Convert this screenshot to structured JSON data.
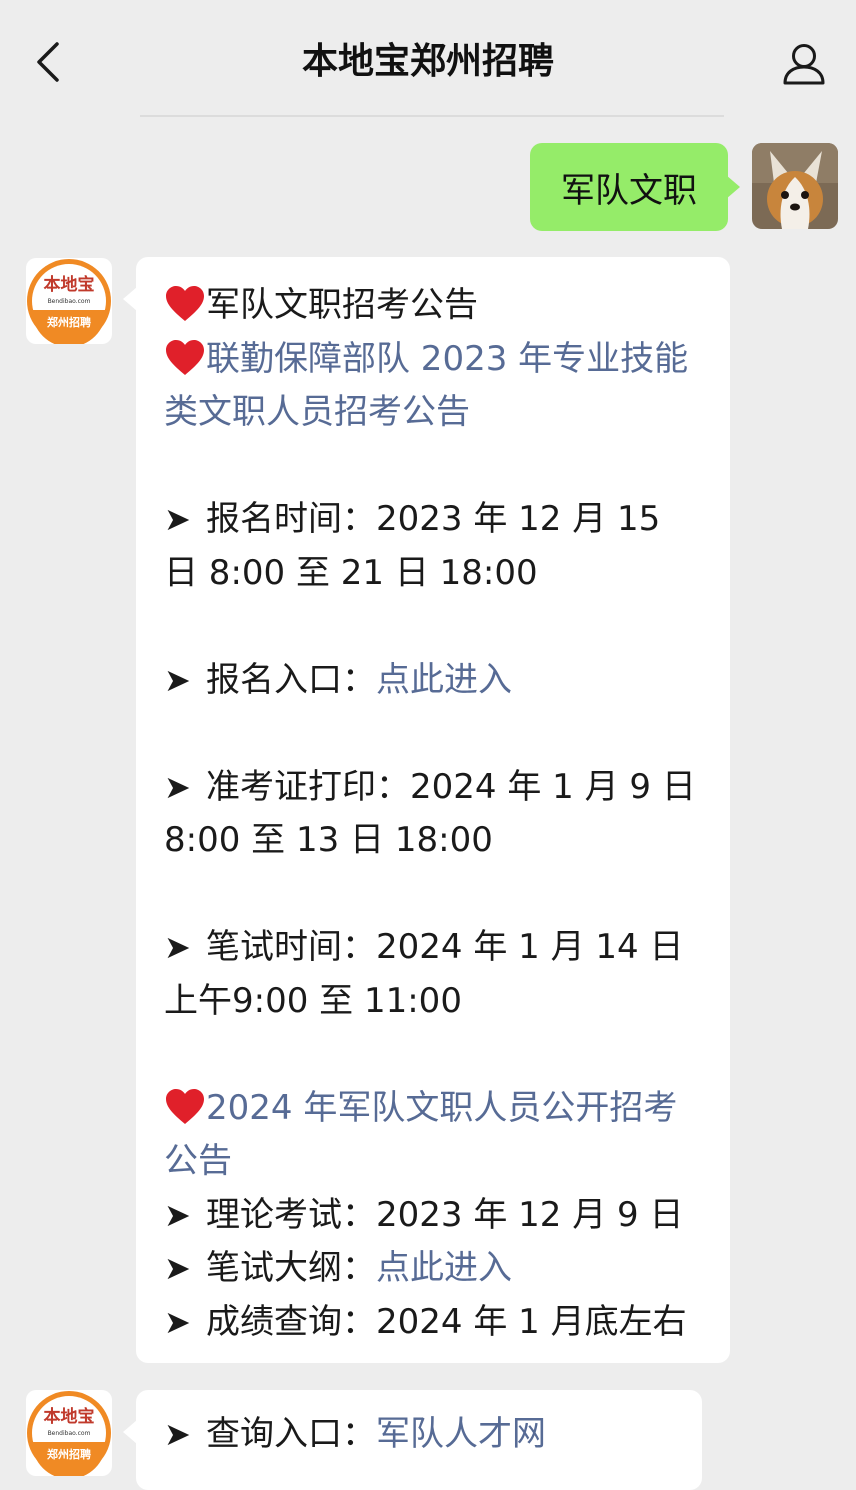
{
  "header": {
    "title": "本地宝郑州招聘"
  },
  "outgoing": {
    "text": "军队文职"
  },
  "bot": {
    "logo_top": "本地宝",
    "logo_url": "Bendibao.com",
    "logo_bottom": "郑州招聘"
  },
  "message1": {
    "heading": "军队文职招考公告",
    "notice1_link": "联勤保障部队 2023 年专业技能类文职人员招考公告",
    "reg_time_label": "报名时间：",
    "reg_time_value": "2023 年 12 月 15 日 8:00 至 21 日 18:00",
    "reg_entry_label": "报名入口：",
    "reg_entry_link": "点此进入",
    "admit_label": "准考证打印：",
    "admit_value": "2024 年 1 月 9 日 8:00 至 13 日 18:00",
    "exam_label": "笔试时间：",
    "exam_value": "2024 年 1 月 14 日上午9:00 至 11:00",
    "notice2_link": "2024 年军队文职人员公开招考公告",
    "theory_label": "理论考试：",
    "theory_value": "2023 年 12 月 9 日",
    "outline_label": "笔试大纲：",
    "outline_link": "点此进入",
    "score_label": "成绩查询：",
    "score_value": "2024 年 1 月底左右"
  },
  "message2": {
    "query_label": "查询入口：",
    "query_link": "军队人才网"
  },
  "colors": {
    "link": "#576b95",
    "bubble_out": "#95ec69",
    "heart": "#e0202a"
  }
}
